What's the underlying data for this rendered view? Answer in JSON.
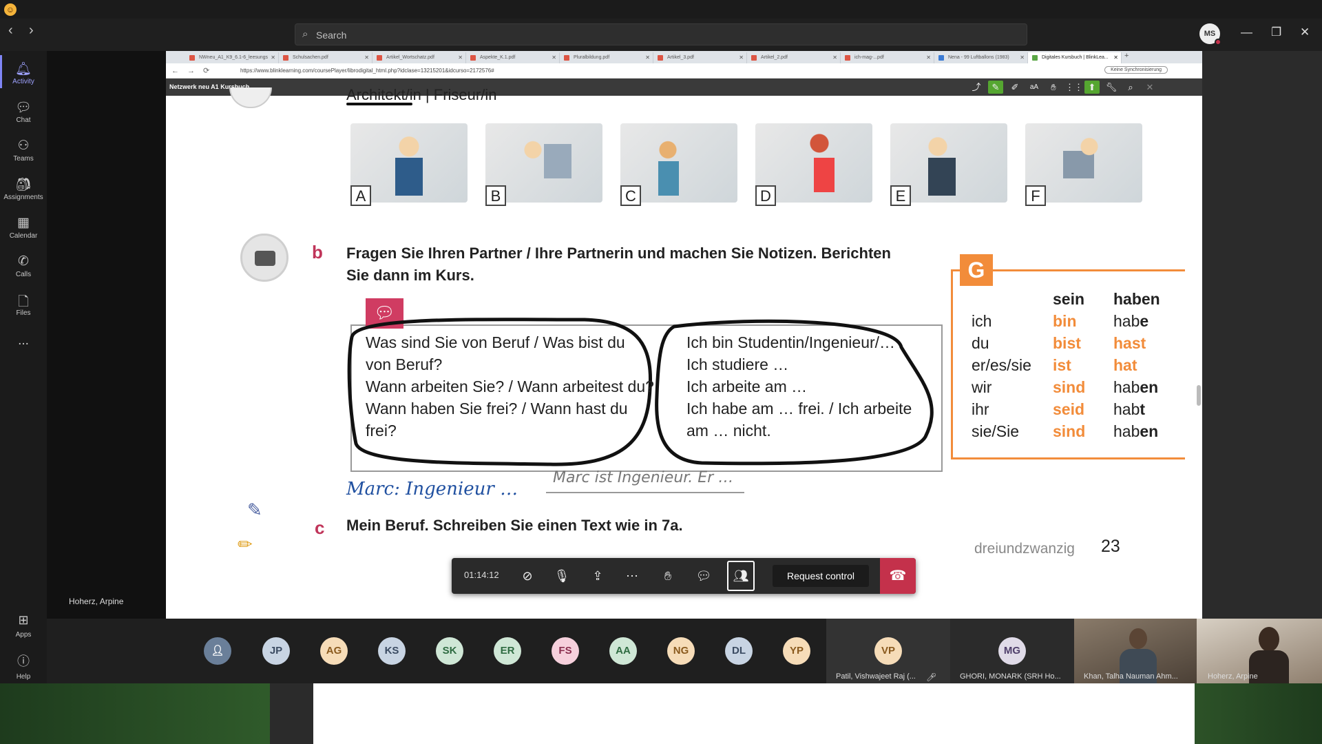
{
  "teams": {
    "search_placeholder": "Search",
    "me_initials": "MS",
    "rail": [
      {
        "label": "Activity",
        "icon": "bell-icon"
      },
      {
        "label": "Chat",
        "icon": "chat-icon"
      },
      {
        "label": "Teams",
        "icon": "teams-icon"
      },
      {
        "label": "Assignments",
        "icon": "assignments-icon"
      },
      {
        "label": "Calendar",
        "icon": "calendar-icon"
      },
      {
        "label": "Calls",
        "icon": "phone-icon"
      },
      {
        "label": "Files",
        "icon": "file-icon"
      }
    ],
    "more": "...",
    "apps_label": "Apps",
    "help_label": "Help",
    "presenter_name": "Hoherz, Arpine"
  },
  "browser": {
    "tabs": [
      "NWneu_A1_K9_6.1-6_leesungs",
      "Schulsachen.pdf",
      "Artikel_Wortschatz.pdf",
      "Aspekte_K.1.pdf",
      "Pluralbildung.pdf",
      "Artikel_3.pdf",
      "Artikel_2.pdf",
      "ich-mag-...pdf",
      "Nena - 99 Luftballons (1983)",
      "Digitales Kursbuch | BlinkLea..."
    ],
    "url": "https://www.blinklearning.com/coursePlayer/librodigital_html.php?idclase=13215201&idcurso=2172576#",
    "sync_label": "Keine Synchronisierung",
    "app_title": "Netzwerk neu A1 Kursbuch"
  },
  "page": {
    "top_partial": "Architekt/in | Friseur/in",
    "pictures": [
      "A",
      "B",
      "C",
      "D",
      "E",
      "F"
    ],
    "task_b_letter": "b",
    "task_b_text_1": "Fragen Sie Ihren Partner / Ihre Partnerin und machen Sie Notizen. Berichten",
    "task_b_text_2": "Sie dann im Kurs.",
    "left_bubble": [
      "Was sind Sie von Beruf / Was bist du",
      "von Beruf?",
      "Wann arbeiten Sie? / Wann arbeitest du?",
      "Wann haben Sie frei? / Wann hast du",
      "frei?"
    ],
    "right_bubble": [
      "Ich bin Studentin/Ingenieur/…",
      "Ich studiere …",
      "Ich arbeite am …",
      "Ich habe am … frei. / Ich arbeite",
      "am … nicht."
    ],
    "grammar": {
      "badge": "G",
      "headers": [
        "sein",
        "haben"
      ],
      "rows": [
        {
          "pronoun": "ich",
          "sein": "bin",
          "haben_stem": "hab",
          "haben_end": "e"
        },
        {
          "pronoun": "du",
          "sein": "bist",
          "haben_stem": "",
          "haben_end": "hast"
        },
        {
          "pronoun": "er/es/sie",
          "sein": "ist",
          "haben_stem": "",
          "haben_end": "hat"
        },
        {
          "pronoun": "wir",
          "sein": "sind",
          "haben_stem": "hab",
          "haben_end": "en"
        },
        {
          "pronoun": "ihr",
          "sein": "seid",
          "haben_stem": "hab",
          "haben_end": "t"
        },
        {
          "pronoun": "sie/Sie",
          "sein": "sind",
          "haben_stem": "hab",
          "haben_end": "en"
        }
      ]
    },
    "handwriting": "Marc: Ingenieur …",
    "example": "Marc ist Ingenieur. Er …",
    "task_c_letter": "c",
    "task_c_text": "Mein Beruf. Schreiben Sie einen Text wie in 7a.",
    "footer_word": "dreiundzwanzig",
    "footer_num": "23"
  },
  "meeting": {
    "timer": "01:14:12",
    "request_control": "Request control"
  },
  "participants": [
    {
      "initials": "JP",
      "bg": "#c8d4e3",
      "fg": "#3b4b62"
    },
    {
      "initials": "AG",
      "bg": "#f6dcb8",
      "fg": "#8a5a1e"
    },
    {
      "initials": "KS",
      "bg": "#c8d4e3",
      "fg": "#3b4b62"
    },
    {
      "initials": "SK",
      "bg": "#cfe7d6",
      "fg": "#2e6b41"
    },
    {
      "initials": "ER",
      "bg": "#cfe7d6",
      "fg": "#2e6b41"
    },
    {
      "initials": "FS",
      "bg": "#f6d0dc",
      "fg": "#8a2e4e"
    },
    {
      "initials": "AA",
      "bg": "#cfe7d6",
      "fg": "#2e6b41"
    },
    {
      "initials": "NG",
      "bg": "#f6dcb8",
      "fg": "#8a5a1e"
    },
    {
      "initials": "DL",
      "bg": "#c8d4e3",
      "fg": "#3b4b62"
    },
    {
      "initials": "YP",
      "bg": "#f6dcb8",
      "fg": "#8a5a1e"
    }
  ],
  "tiles": [
    {
      "initials": "VP",
      "name": "Patil, Vishwajeet Raj (...",
      "bg": "#f6dcb8",
      "fg": "#8a5a1e"
    },
    {
      "initials": "MG",
      "name": "GHORI, MONARK (SRH Ho...",
      "bg": "#e0dbe8",
      "fg": "#4e3e6a"
    }
  ],
  "video_tiles": [
    {
      "name": "Khan, Talha Nauman Ahm..."
    },
    {
      "name": "Hoherz, Arpine"
    }
  ]
}
